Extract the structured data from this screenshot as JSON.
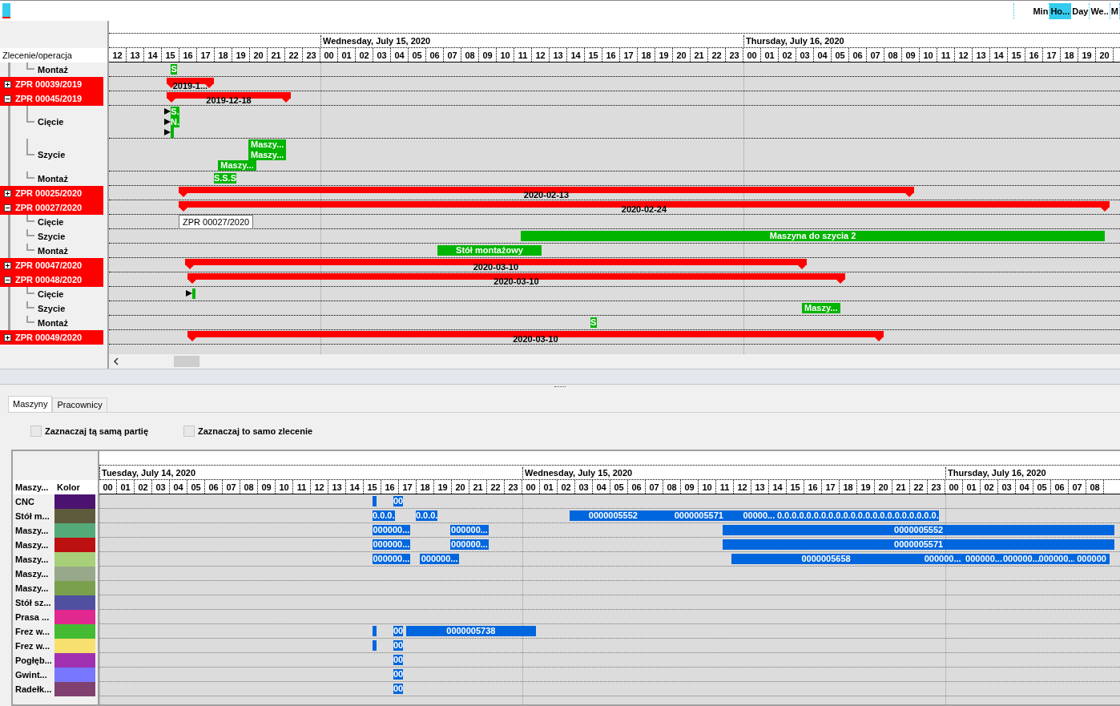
{
  "toolbar": {
    "zoom_buttons": [
      {
        "label": "Min",
        "selected": false
      },
      {
        "label": "Ho...",
        "selected": true
      },
      {
        "label": "Day",
        "selected": false
      },
      {
        "label": "We..",
        "selected": false
      },
      {
        "label": "M",
        "selected": false
      }
    ]
  },
  "orders_gantt": {
    "column_header": "Zlecenie/operacja",
    "days": [
      "Wednesday, July 15, 2020",
      "Thursday, July 16, 2020"
    ],
    "hours": [
      "12",
      "13",
      "14",
      "15",
      "16",
      "17",
      "18",
      "19",
      "20",
      "21",
      "22",
      "23",
      "00",
      "01",
      "02",
      "03",
      "04",
      "05",
      "06",
      "07",
      "08",
      "09",
      "10",
      "11",
      "12",
      "13",
      "14",
      "15",
      "16",
      "17",
      "18",
      "19",
      "20",
      "21",
      "22",
      "23",
      "00",
      "01",
      "02",
      "03",
      "04",
      "05",
      "06",
      "07",
      "08",
      "09",
      "10",
      "11",
      "12",
      "13",
      "14",
      "15",
      "16",
      "17",
      "18",
      "19",
      "20"
    ],
    "rows": [
      {
        "kind": "operation",
        "label": "Montaż",
        "bars": [
          {
            "kind": "task",
            "label": "S"
          }
        ]
      },
      {
        "kind": "order",
        "label": "ZPR 00039/2019",
        "expanded": false,
        "bars": [
          {
            "kind": "summary",
            "label": "2019-1..."
          }
        ]
      },
      {
        "kind": "order",
        "label": "ZPR 00045/2019",
        "expanded": true,
        "bars": [
          {
            "kind": "summary",
            "label": "2019-12-18"
          }
        ]
      },
      {
        "kind": "operation",
        "label": "Cięcie",
        "bars": [
          {
            "kind": "task",
            "label": "S."
          },
          {
            "kind": "task",
            "label": "N."
          },
          {
            "kind": "task"
          }
        ]
      },
      {
        "kind": "operation",
        "label": "Szycie",
        "bars": [
          {
            "kind": "task",
            "label": "Maszy..."
          },
          {
            "kind": "task",
            "label": "Maszy..."
          },
          {
            "kind": "task",
            "label": "Maszy..."
          }
        ]
      },
      {
        "kind": "operation",
        "label": "Montaż",
        "bars": [
          {
            "kind": "task",
            "label": "S.S.S"
          }
        ]
      },
      {
        "kind": "order",
        "label": "ZPR 00025/2020",
        "expanded": false,
        "bars": [
          {
            "kind": "summary",
            "label": "2020-02-13"
          }
        ]
      },
      {
        "kind": "order",
        "label": "ZPR 00027/2020",
        "expanded": true,
        "bars": [
          {
            "kind": "summary",
            "label": "2020-02-24"
          }
        ]
      },
      {
        "kind": "operation",
        "label": "Cięcie",
        "tooltip": "ZPR 00027/2020"
      },
      {
        "kind": "operation",
        "label": "Szycie",
        "bars": [
          {
            "kind": "task",
            "label": "Maszyna do szycia 2"
          }
        ]
      },
      {
        "kind": "operation",
        "label": "Montaż",
        "bars": [
          {
            "kind": "task",
            "label": "Stół montażowy"
          }
        ]
      },
      {
        "kind": "order",
        "label": "ZPR 00047/2020",
        "expanded": false,
        "bars": [
          {
            "kind": "summary",
            "label": "2020-03-10"
          }
        ]
      },
      {
        "kind": "order",
        "label": "ZPR 00048/2020",
        "expanded": true,
        "bars": [
          {
            "kind": "summary",
            "label": "2020-03-10"
          }
        ]
      },
      {
        "kind": "operation",
        "label": "Cięcie",
        "bars": [
          {
            "kind": "task"
          }
        ]
      },
      {
        "kind": "operation",
        "label": "Szycie",
        "bars": [
          {
            "kind": "task",
            "label": "Maszy..."
          }
        ]
      },
      {
        "kind": "operation",
        "label": "Montaż",
        "bars": [
          {
            "kind": "task",
            "label": "S"
          }
        ]
      },
      {
        "kind": "order",
        "label": "ZPR 00049/2020",
        "expanded": false,
        "bars": [
          {
            "kind": "summary",
            "label": "2020-03-10"
          }
        ]
      }
    ]
  },
  "tabs": [
    {
      "label": "Maszyny",
      "selected": true
    },
    {
      "label": "Pracownicy",
      "selected": false
    }
  ],
  "options": [
    {
      "label": "Zaznaczaj tą samą partię",
      "checked": false
    },
    {
      "label": "Zaznaczaj to samo zlecenie",
      "checked": false
    }
  ],
  "machines_gantt": {
    "columns": [
      "Maszy...",
      "Kolor"
    ],
    "days": [
      "Tuesday, July 14, 2020",
      "Wednesday, July 15, 2020",
      "Thursday, July 16, 2020"
    ],
    "hours": [
      "00",
      "01",
      "02",
      "03",
      "04",
      "05",
      "06",
      "07",
      "08",
      "09",
      "10",
      "11",
      "12",
      "13",
      "14",
      "15",
      "16",
      "17",
      "18",
      "19",
      "20",
      "21",
      "22",
      "23",
      "00",
      "01",
      "02",
      "03",
      "04",
      "05",
      "06",
      "07",
      "08",
      "09",
      "10",
      "11",
      "12",
      "13",
      "14",
      "15",
      "16",
      "17",
      "18",
      "19",
      "20",
      "21",
      "22",
      "23",
      "00",
      "01",
      "02",
      "03",
      "04",
      "05",
      "06",
      "07",
      "08"
    ],
    "rows": [
      {
        "label": "CNC",
        "color": "#4b136f",
        "bars": [
          {
            "kind": "marker"
          },
          {
            "kind": "task",
            "label": "00"
          }
        ]
      },
      {
        "label": "Stół m...",
        "color": "#5e5a3c",
        "bars": [
          {
            "kind": "task",
            "label": "0.0.0."
          },
          {
            "kind": "task",
            "label": "0.0.0."
          },
          {
            "kind": "task",
            "label": "0000005552"
          },
          {
            "kind": "task",
            "label": "0000005571"
          },
          {
            "kind": "task",
            "label": "00000..."
          },
          {
            "kind": "task",
            "label": "0.0.0.0.0.0.0.0.0.0.0.0.0.0.0.0.0.0.0.0.0.0."
          }
        ]
      },
      {
        "label": "Maszy...",
        "color": "#55aa7a",
        "bars": [
          {
            "kind": "task",
            "label": "000000..."
          },
          {
            "kind": "task",
            "label": "000000..."
          },
          {
            "kind": "task",
            "label": "0000005552"
          }
        ]
      },
      {
        "label": "Maszy...",
        "color": "#bb1111",
        "bars": [
          {
            "kind": "task",
            "label": "000000..."
          },
          {
            "kind": "task",
            "label": "000000..."
          },
          {
            "kind": "task",
            "label": "0000005571"
          }
        ]
      },
      {
        "label": "Maszy...",
        "color": "#a8d07a",
        "bars": [
          {
            "kind": "task",
            "label": "000000..."
          },
          {
            "kind": "task",
            "label": "000000..."
          },
          {
            "kind": "task",
            "label": "0000005658"
          },
          {
            "kind": "task",
            "label": "000000..."
          },
          {
            "kind": "task",
            "label": "000000..."
          },
          {
            "kind": "task",
            "label": "000000..."
          },
          {
            "kind": "task",
            "label": "000000..."
          },
          {
            "kind": "task",
            "label": "000000"
          }
        ]
      },
      {
        "label": "Maszy...",
        "color": "#98a88a"
      },
      {
        "label": "Maszy...",
        "color": "#7aa04e"
      },
      {
        "label": "Stół sz...",
        "color": "#5050a0"
      },
      {
        "label": "Prasa ...",
        "color": "#e0288e"
      },
      {
        "label": "Frez w...",
        "color": "#44bb33",
        "bars": [
          {
            "kind": "marker"
          },
          {
            "kind": "task",
            "label": "00"
          },
          {
            "kind": "task",
            "label": "0000005738"
          }
        ]
      },
      {
        "label": "Frez w...",
        "color": "#f8e070",
        "bars": [
          {
            "kind": "marker"
          },
          {
            "kind": "task",
            "label": "00"
          }
        ]
      },
      {
        "label": "Pogłęb...",
        "color": "#a030b0",
        "bars": [
          {
            "kind": "task",
            "label": "00"
          }
        ]
      },
      {
        "label": "Gwint...",
        "color": "#7878ff",
        "bars": [
          {
            "kind": "task",
            "label": "00"
          }
        ]
      },
      {
        "label": "Radełk...",
        "color": "#804070",
        "bars": [
          {
            "kind": "task",
            "label": "00"
          }
        ]
      }
    ]
  }
}
